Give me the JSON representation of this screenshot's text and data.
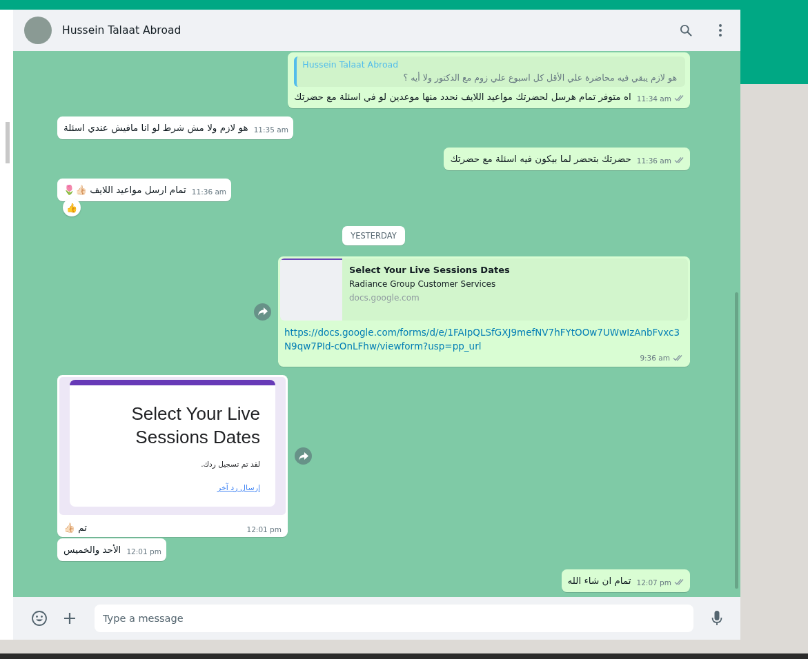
{
  "chat_header": {
    "contact_name": "Hussein Talaat Abroad"
  },
  "messages": [
    {
      "kind": "text",
      "outgoing": true,
      "quote": {
        "author": "Hussein Talaat Abroad",
        "text": "هو لازم يبقي فيه محاضرة علي الأقل كل اسبوع علي زوم مع الدكتور ولا أيه ؟"
      },
      "text": "اه متوفر تمام هرسل لحضرتك مواعيد اللايف نحدد منها موعدين لو في اسئلة مع حضرتك",
      "time": "11:34 am",
      "read": false
    },
    {
      "kind": "text",
      "outgoing": false,
      "text": "هو لازم ولا مش شرط لو انا مافيش عندي اسئلة",
      "time": "11:35 am"
    },
    {
      "kind": "text",
      "outgoing": true,
      "text": "حضرتك بتحضر لما بيكون فيه اسئلة مع حضرتك",
      "time": "11:36 am",
      "read": false
    },
    {
      "kind": "text",
      "outgoing": false,
      "text": "تمام ارسل مواعيد اللايف 👍🏻🌷",
      "time": "11:36 am",
      "reaction": "👍"
    },
    {
      "kind": "date",
      "text": "YESTERDAY"
    },
    {
      "kind": "link",
      "outgoing": true,
      "forward": true,
      "preview": {
        "title": "Select Your Live Sessions Dates",
        "description": "Radiance Group Customer Services",
        "domain": "docs.google.com"
      },
      "text": "https://docs.google.com/forms/d/e/1FAIpQLSfGXJ9mefNV7hFYtOOw7UWwIzAnbFvxc3N9qw7PId-cOnLFhw/viewform?usp=pp_url",
      "time": "9:36 am",
      "read": false
    },
    {
      "kind": "image",
      "outgoing": false,
      "forward": true,
      "form": {
        "title": "Select Your Live Sessions Dates",
        "note": "لقد تم تسجيل ردك.",
        "link": "إرسال رد آخر"
      },
      "text": "تم 👍🏻",
      "time": "12:01 pm"
    },
    {
      "kind": "text",
      "outgoing": false,
      "text": "الأحد والخميس",
      "time": "12:01 pm"
    },
    {
      "kind": "text",
      "outgoing": true,
      "text": "تمام ان شاء الله",
      "time": "12:07 pm",
      "read": false
    }
  ],
  "composer": {
    "placeholder": "Type a message"
  }
}
